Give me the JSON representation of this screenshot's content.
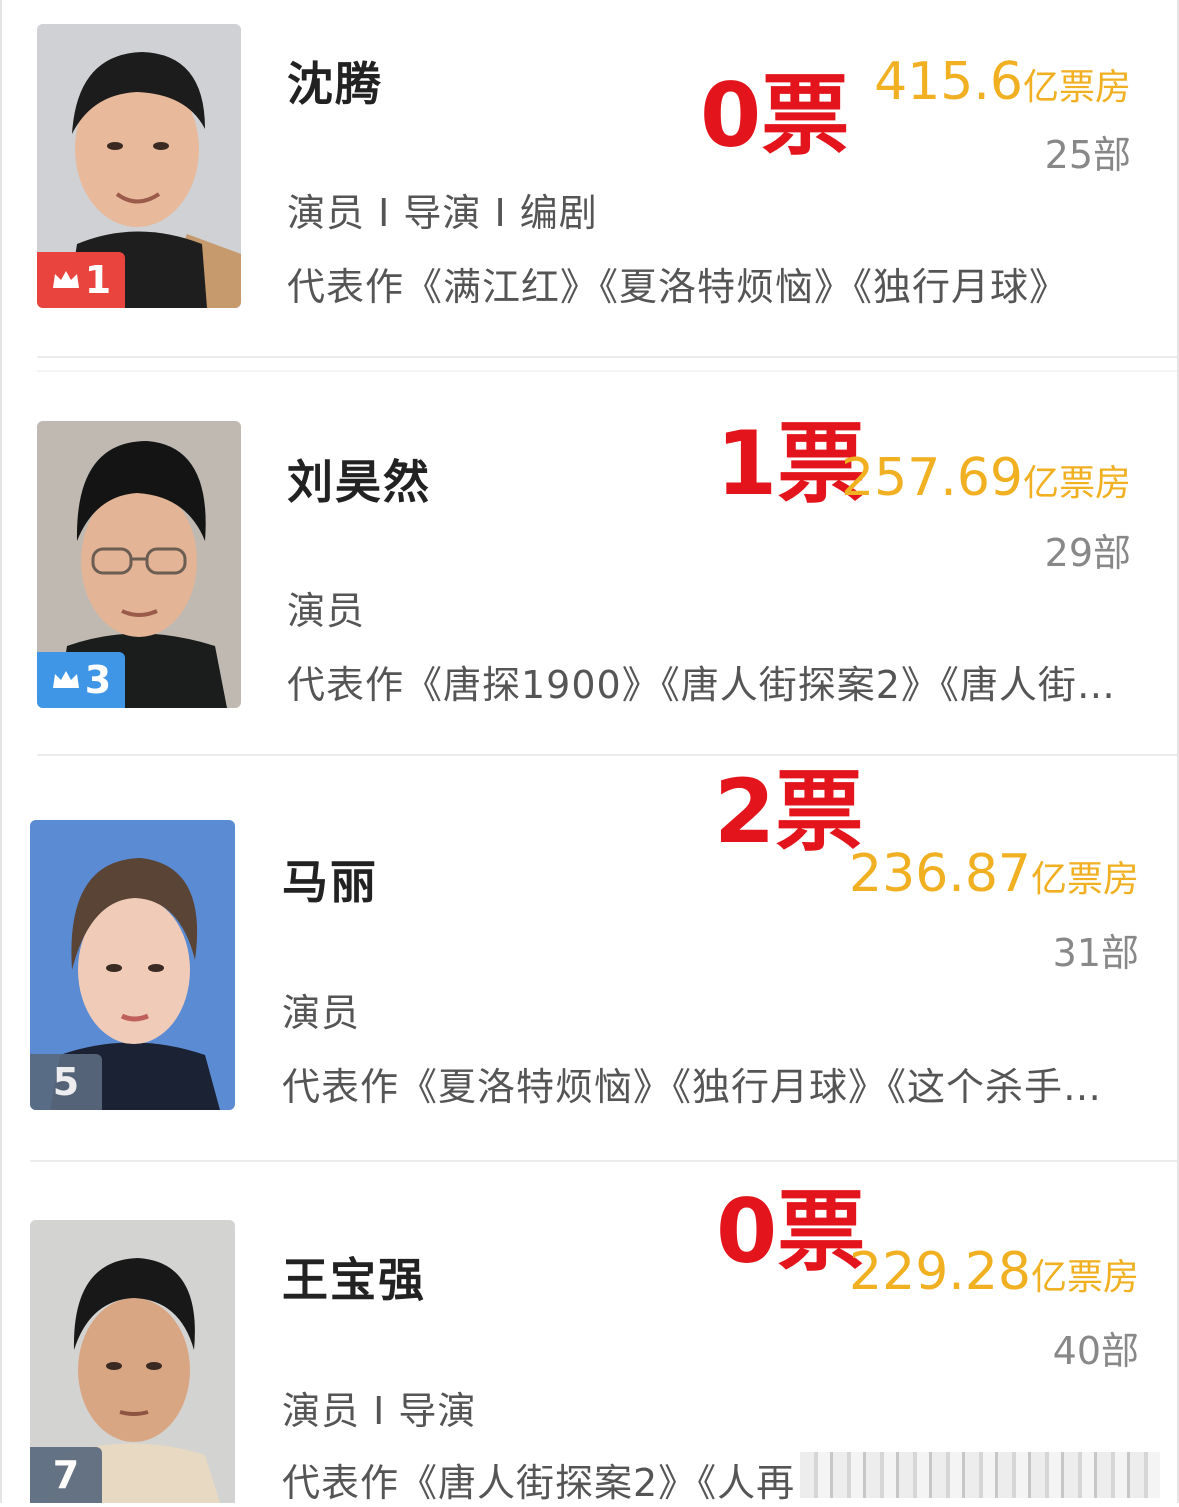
{
  "entries": [
    {
      "name": "沈腾",
      "roles": "演员 I 导演 I 编剧",
      "works": "代表作《满江红》《夏洛特烦恼》《独行月球》",
      "votes": "0票",
      "box_office_value": "415.6",
      "box_office_unit": "亿票房",
      "film_count": "25部",
      "rank": "1",
      "rank_badge": "crown-red"
    },
    {
      "name": "刘昊然",
      "roles": "演员",
      "works": "代表作《唐探1900》《唐人街探案2》《唐人街…",
      "votes": "1票",
      "box_office_value": "257.69",
      "box_office_unit": "亿票房",
      "film_count": "29部",
      "rank": "3",
      "rank_badge": "crown-blue"
    },
    {
      "name": "马丽",
      "roles": "演员",
      "works": "代表作《夏洛特烦恼》《独行月球》《这个杀手…",
      "votes": "2票",
      "box_office_value": "236.87",
      "box_office_unit": "亿票房",
      "film_count": "31部",
      "rank": "5",
      "rank_badge": "plain"
    },
    {
      "name": "王宝强",
      "roles": "演员 I 导演",
      "works": "代表作《唐人街探案2》《人再",
      "votes": "0票",
      "box_office_value": "229.28",
      "box_office_unit": "亿票房",
      "film_count": "40部",
      "rank": "7",
      "rank_badge": "plain"
    }
  ],
  "colors": {
    "votes": "#e3141b",
    "box_office": "#f0b021",
    "rank_red": "#e9443d",
    "rank_blue": "#3f96e6",
    "rank_gray": "#5a6a7e"
  }
}
